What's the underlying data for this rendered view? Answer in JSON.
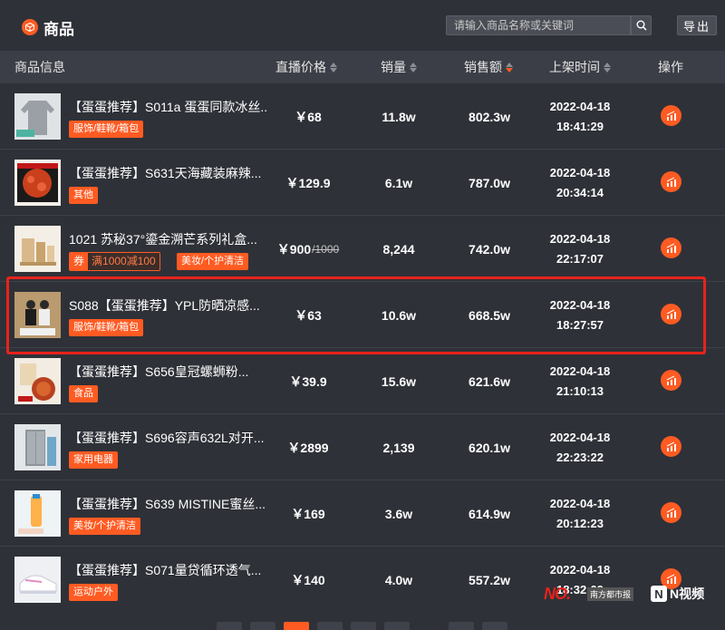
{
  "header": {
    "title": "商品",
    "search_placeholder": "请输入商品名称或关键词",
    "export_label": "导出"
  },
  "columns": [
    {
      "label": "商品信息"
    },
    {
      "label": "直播价格"
    },
    {
      "label": "销量"
    },
    {
      "label": "销售额"
    },
    {
      "label": "上架时间"
    },
    {
      "label": "操作"
    }
  ],
  "rows": [
    {
      "name": "【蛋蛋推荐】S011a 蛋蛋同款冰丝...",
      "tag": "服饰/鞋靴/箱包",
      "price": "￥68",
      "sales": "11.8w",
      "revenue": "802.3w",
      "date": "2022-04-18",
      "time": "18:41:29"
    },
    {
      "name": "【蛋蛋推荐】S631天海藏装麻辣...",
      "tag": "其他",
      "price": "￥129.9",
      "sales": "6.1w",
      "revenue": "787.0w",
      "date": "2022-04-18",
      "time": "20:34:14"
    },
    {
      "name": "1021 苏秘37°鎏金溯芒系列礼盒...",
      "coupon_label": "券",
      "coupon_text": "满1000减100",
      "tag": "美妆/个护清洁",
      "price": "￥900",
      "orig_price": "/1000",
      "sales": "8,244",
      "revenue": "742.0w",
      "date": "2022-04-18",
      "time": "22:17:07"
    },
    {
      "name": "S088【蛋蛋推荐】YPL防晒凉感...",
      "tag": "服饰/鞋靴/箱包",
      "price": "￥63",
      "sales": "10.6w",
      "revenue": "668.5w",
      "date": "2022-04-18",
      "time": "18:27:57"
    },
    {
      "name": "【蛋蛋推荐】S656皇冠螺蛳粉...",
      "tag": "食品",
      "price": "￥39.9",
      "sales": "15.6w",
      "revenue": "621.6w",
      "date": "2022-04-18",
      "time": "21:10:13"
    },
    {
      "name": "【蛋蛋推荐】S696容声632L对开...",
      "tag": "家用电器",
      "price": "￥2899",
      "sales": "2,139",
      "revenue": "620.1w",
      "date": "2022-04-18",
      "time": "22:23:22"
    },
    {
      "name": "【蛋蛋推荐】S639 MISTINE蜜丝...",
      "tag": "美妆/个护清洁",
      "price": "￥169",
      "sales": "3.6w",
      "revenue": "614.9w",
      "date": "2022-04-18",
      "time": "20:12:23"
    },
    {
      "name": "【蛋蛋推荐】S071量贷循环透气...",
      "tag": "运动户外",
      "price": "￥140",
      "sales": "4.0w",
      "revenue": "557.2w",
      "date": "2022-04-18",
      "time": "18:32:09"
    }
  ],
  "watermark": {
    "brand_a": "NO.",
    "brand_a_sub": "南方都市报",
    "brand_b": "N视频"
  },
  "colors": {
    "accent": "#ff5b22",
    "highlight": "#e8231c",
    "background": "#2f3138"
  }
}
